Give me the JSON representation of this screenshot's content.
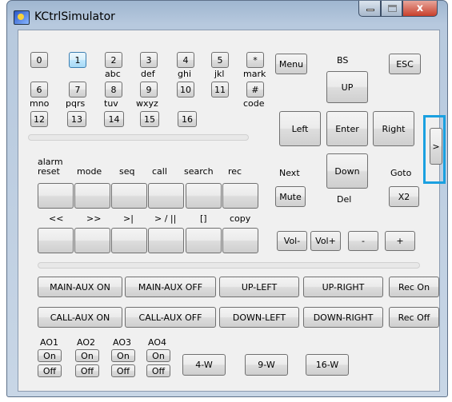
{
  "window": {
    "title": "KCtrlSimulator",
    "close_glyph": "x"
  },
  "keypad": {
    "row1": [
      {
        "label": "0",
        "sub": ""
      },
      {
        "label": "1",
        "sub": "",
        "selected": true
      },
      {
        "label": "2",
        "sub": "abc"
      },
      {
        "label": "3",
        "sub": "def"
      },
      {
        "label": "4",
        "sub": "ghi"
      },
      {
        "label": "5",
        "sub": "jkl"
      },
      {
        "label": "*",
        "sub": "mark"
      }
    ],
    "row2": [
      {
        "label": "6",
        "top": "mno"
      },
      {
        "label": "7",
        "top": "pqrs"
      },
      {
        "label": "8",
        "top": "tuv"
      },
      {
        "label": "9",
        "top": "wxyz"
      },
      {
        "label": "10",
        "top": ""
      },
      {
        "label": "11",
        "top": ""
      },
      {
        "label": "#",
        "top": "code"
      }
    ],
    "row3": [
      "12",
      "13",
      "14",
      "15",
      "16"
    ]
  },
  "nav": {
    "menu": "Menu",
    "bs": "BS",
    "esc": "ESC",
    "up": "UP",
    "left": "Left",
    "enter": "Enter",
    "right": "Right",
    "down": "Down",
    "del": "Del",
    "next": "Next",
    "mute": "Mute",
    "goto": "Goto",
    "x2": "X2",
    "expand": ">"
  },
  "function_labels": [
    "alarm\nreset",
    "mode",
    "seq",
    "call",
    "search",
    "rec"
  ],
  "transport_labels": [
    "<<",
    ">>",
    ">|",
    "> / ||",
    "[]",
    "copy"
  ],
  "volume": {
    "vol_down": "Vol-",
    "vol_up": "Vol+",
    "minus": "-",
    "plus": "+"
  },
  "aux": {
    "main_on": "MAIN-AUX ON",
    "main_off": "MAIN-AUX OFF",
    "up_left": "UP-LEFT",
    "up_right": "UP-RIGHT",
    "rec_on": "Rec On",
    "call_on": "CALL-AUX ON",
    "call_off": "CALL-AUX OFF",
    "down_left": "DOWN-LEFT",
    "down_right": "DOWN-RIGHT",
    "rec_off": "Rec Off"
  },
  "ao": {
    "labels": [
      "AO1",
      "AO2",
      "AO3",
      "AO4"
    ],
    "on": "On",
    "off": "Off",
    "modes": [
      "4-W",
      "9-W",
      "16-W"
    ]
  }
}
